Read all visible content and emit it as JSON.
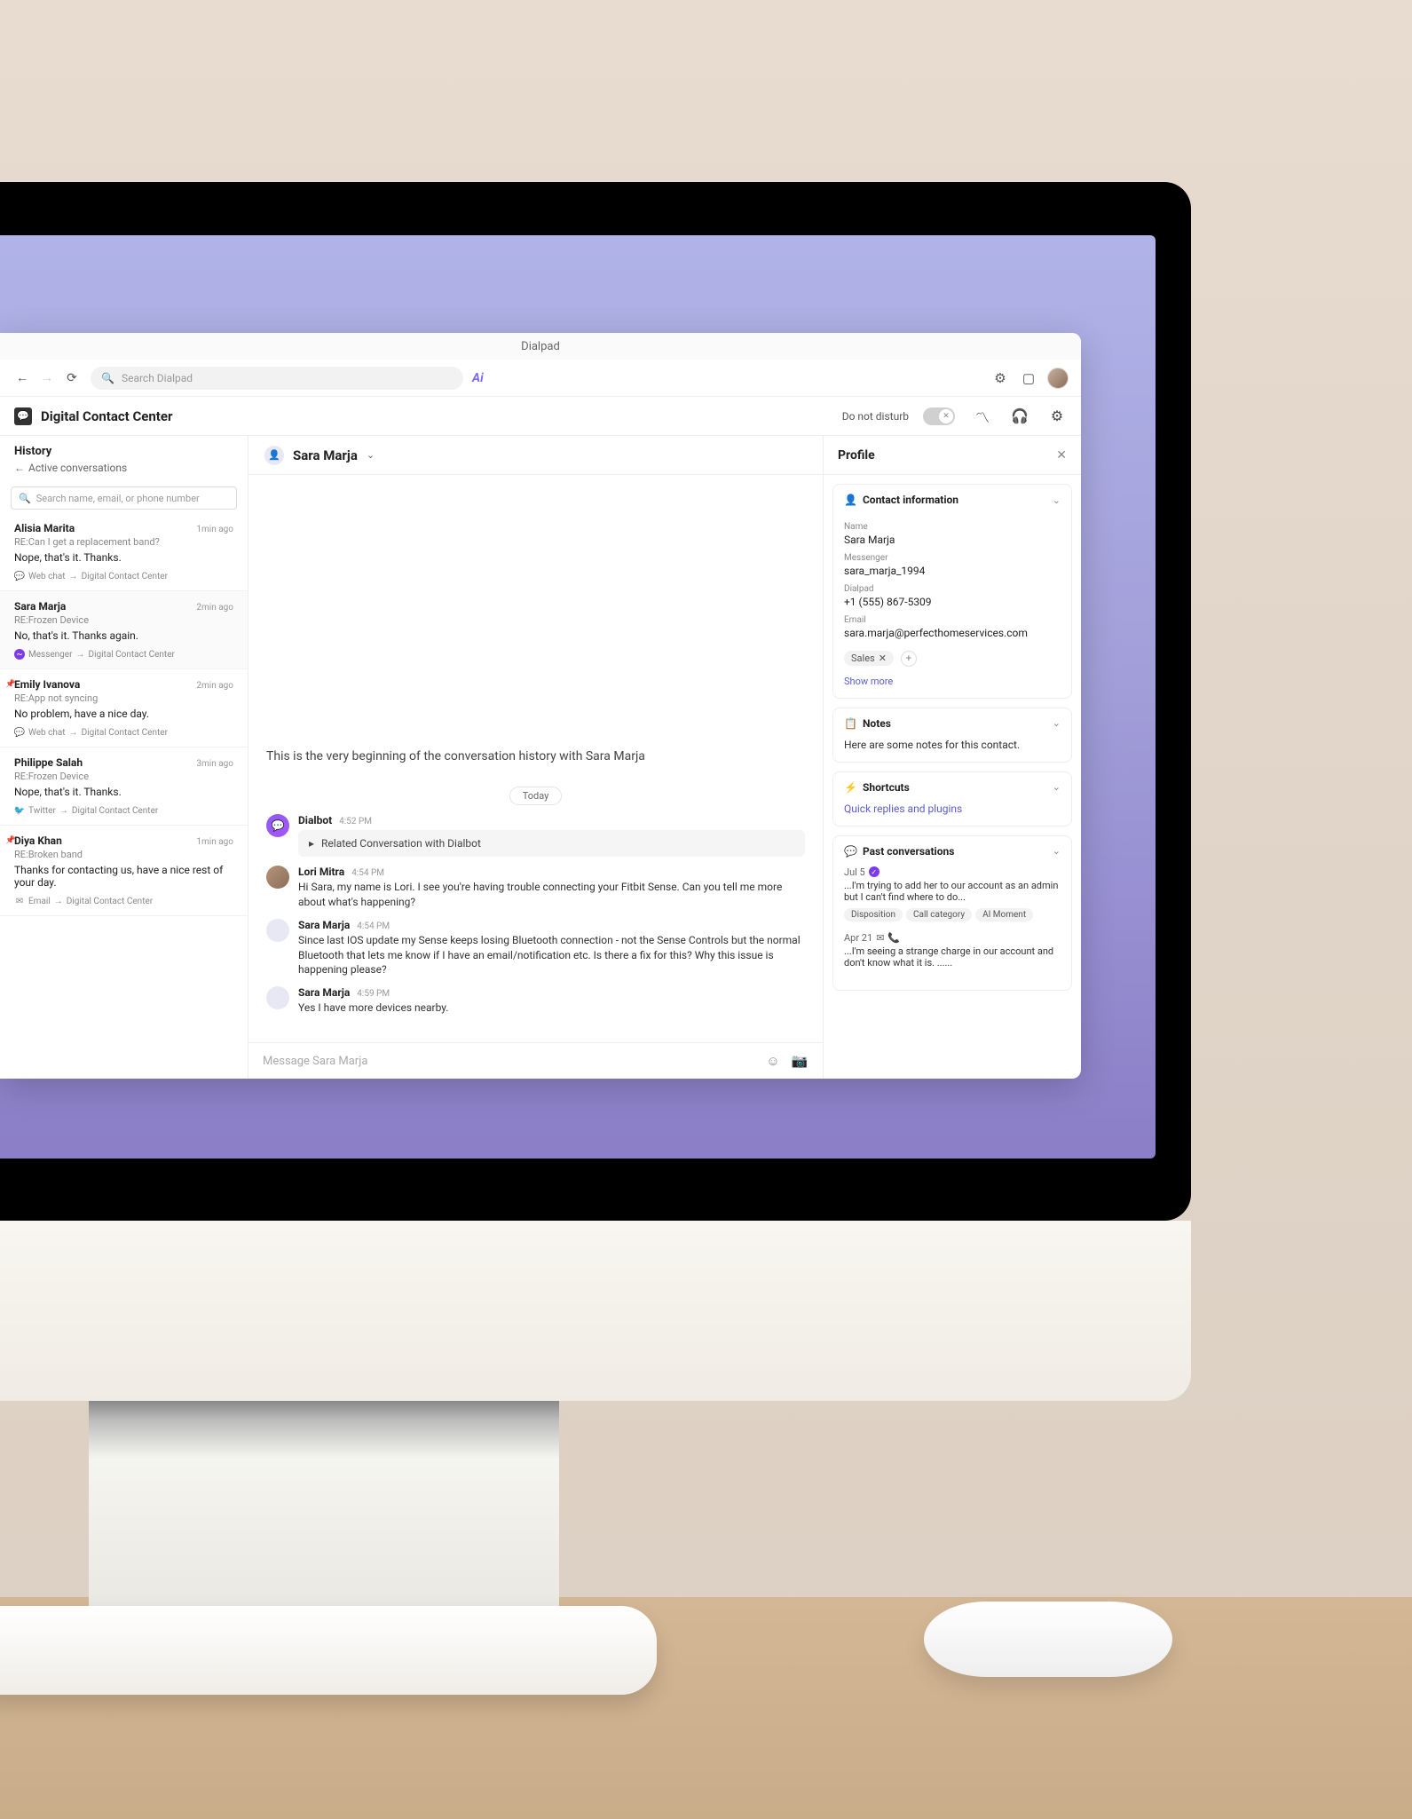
{
  "window": {
    "title": "Dialpad",
    "search_placeholder": "Search Dialpad"
  },
  "header": {
    "page_title": "Digital Contact Center",
    "dnd_label": "Do not disturb"
  },
  "sidebar": {
    "title": "History",
    "back_label": "Active conversations",
    "filter_placeholder": "Search name, email, or phone number",
    "items": [
      {
        "name": "Alisia Marita",
        "time": "1min ago",
        "subject": "RE:Can I get a replacement band?",
        "preview": "Nope, that's it. Thanks.",
        "source": "Web chat",
        "dest": "Digital Contact Center",
        "srcicon": "web"
      },
      {
        "name": "Sara Marja",
        "time": "2min ago",
        "subject": "RE:Frozen Device",
        "preview": "No, that's it. Thanks again.",
        "source": "Messenger",
        "dest": "Digital Contact Center",
        "srcicon": "messenger"
      },
      {
        "name": "Emily Ivanova",
        "time": "2min ago",
        "subject": "RE:App not syncing",
        "preview": "No problem, have a nice day.",
        "source": "Web chat",
        "dest": "Digital Contact Center",
        "srcicon": "web",
        "pinned": true
      },
      {
        "name": "Philippe Salah",
        "time": "3min ago",
        "subject": "RE:Frozen Device",
        "preview": "Nope, that's it. Thanks.",
        "source": "Twitter",
        "dest": "Digital Contact Center",
        "srcicon": "twitter"
      },
      {
        "name": "Diya Khan",
        "time": "1min ago",
        "subject": "RE:Broken band",
        "preview": "Thanks for contacting us, have a nice rest of your day.",
        "source": "Email",
        "dest": "Digital Contact Center",
        "srcicon": "envelope",
        "pinned": true
      }
    ]
  },
  "chat": {
    "contact_name": "Sara Marja",
    "beginning_text": "This is the very beginning of the conversation history with Sara Marja",
    "date_label": "Today",
    "messages": [
      {
        "sender": "Dialbot",
        "time": "4:52 PM",
        "related": "Related Conversation with Dialbot",
        "av": "bot"
      },
      {
        "sender": "Lori Mitra",
        "time": "4:54 PM",
        "text": "Hi Sara, my name is Lori. I see you're having trouble connecting your Fitbit Sense. Can you tell me more about what's happening?",
        "av": "lori"
      },
      {
        "sender": "Sara Marja",
        "time": "4:54 PM",
        "text": "Since last IOS update my Sense keeps losing Bluetooth connection - not the Sense Controls but the normal Bluetooth that lets me know if I have an email/notification etc. Is there a fix for this? Why this issue is happening please?",
        "av": "sara"
      },
      {
        "sender": "Sara Marja",
        "time": "4:59 PM",
        "text": "Yes I have more devices nearby.",
        "av": "sara"
      }
    ],
    "composer_placeholder": "Message Sara Marja"
  },
  "profile": {
    "title": "Profile",
    "contact_info": {
      "heading": "Contact information",
      "name_label": "Name",
      "name_value": "Sara Marja",
      "messenger_label": "Messenger",
      "messenger_value": "sara_marja_1994",
      "dialpad_label": "Dialpad",
      "dialpad_value": "+1 (555) 867-5309",
      "email_label": "Email",
      "email_value": "sara.marja@perfecthomeservices.com",
      "tag": "Sales",
      "show_more": "Show more"
    },
    "notes": {
      "heading": "Notes",
      "text": "Here are some notes for this contact."
    },
    "shortcuts": {
      "heading": "Shortcuts",
      "link": "Quick replies and plugins"
    },
    "past": {
      "heading": "Past conversations",
      "items": [
        {
          "date": "Jul 5",
          "text": "...I'm trying to add her to our account as an admin but I can't find where to do...",
          "chips": [
            "Disposition",
            "Call category",
            "AI Moment"
          ],
          "verified": true
        },
        {
          "date": "Apr 21",
          "text": "...I'm seeing a strange charge in our account and don't know what it is. ......",
          "icons": true
        }
      ]
    }
  }
}
